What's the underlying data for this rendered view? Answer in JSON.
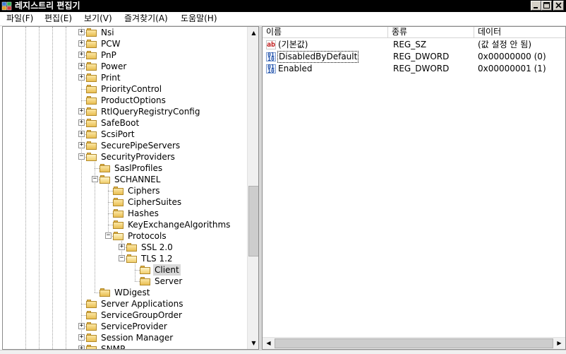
{
  "window": {
    "title": "레지스트리 편집기",
    "icon": "registry-editor-icon",
    "controls": {
      "minimize": "minimize-icon",
      "maximize": "maximize-icon",
      "close": "close-icon"
    }
  },
  "menu": [
    {
      "label": "파일(F)"
    },
    {
      "label": "편집(E)"
    },
    {
      "label": "보기(V)"
    },
    {
      "label": "즐겨찾기(A)"
    },
    {
      "label": "도움말(H)"
    }
  ],
  "tree": {
    "nodes": [
      {
        "label": "Nsi",
        "level": 0,
        "expander": "+"
      },
      {
        "label": "PCW",
        "level": 0,
        "expander": "+"
      },
      {
        "label": "PnP",
        "level": 0,
        "expander": "+"
      },
      {
        "label": "Power",
        "level": 0,
        "expander": "+"
      },
      {
        "label": "Print",
        "level": 0,
        "expander": "+"
      },
      {
        "label": "PriorityControl",
        "level": 0,
        "expander": ""
      },
      {
        "label": "ProductOptions",
        "level": 0,
        "expander": ""
      },
      {
        "label": "RtlQueryRegistryConfig",
        "level": 0,
        "expander": "+"
      },
      {
        "label": "SafeBoot",
        "level": 0,
        "expander": "+"
      },
      {
        "label": "ScsiPort",
        "level": 0,
        "expander": "+"
      },
      {
        "label": "SecurePipeServers",
        "level": 0,
        "expander": "+"
      },
      {
        "label": "SecurityProviders",
        "level": 0,
        "expander": "-"
      },
      {
        "label": "SaslProfiles",
        "level": 1,
        "expander": ""
      },
      {
        "label": "SCHANNEL",
        "level": 1,
        "expander": "-"
      },
      {
        "label": "Ciphers",
        "level": 2,
        "expander": ""
      },
      {
        "label": "CipherSuites",
        "level": 2,
        "expander": ""
      },
      {
        "label": "Hashes",
        "level": 2,
        "expander": ""
      },
      {
        "label": "KeyExchangeAlgorithms",
        "level": 2,
        "expander": ""
      },
      {
        "label": "Protocols",
        "level": 2,
        "expander": "-"
      },
      {
        "label": "SSL 2.0",
        "level": 3,
        "expander": "+"
      },
      {
        "label": "TLS 1.2",
        "level": 3,
        "expander": "-"
      },
      {
        "label": "Client",
        "level": 4,
        "expander": "",
        "selected": true
      },
      {
        "label": "Server",
        "level": 4,
        "expander": ""
      },
      {
        "label": "WDigest",
        "level": 1,
        "expander": ""
      },
      {
        "label": "Server Applications",
        "level": 0,
        "expander": ""
      },
      {
        "label": "ServiceGroupOrder",
        "level": 0,
        "expander": ""
      },
      {
        "label": "ServiceProvider",
        "level": 0,
        "expander": "+"
      },
      {
        "label": "Session Manager",
        "level": 0,
        "expander": "+"
      },
      {
        "label": "SNMP",
        "level": 0,
        "expander": "+"
      }
    ]
  },
  "list": {
    "columns": [
      {
        "label": "이름"
      },
      {
        "label": "종류"
      },
      {
        "label": "데이터"
      }
    ],
    "rows": [
      {
        "icon": "string-value-icon",
        "name": "(기본값)",
        "type": "REG_SZ",
        "data": "(값 설정 안 됨)"
      },
      {
        "icon": "binary-value-icon",
        "name": "DisabledByDefault",
        "type": "REG_DWORD",
        "data": "0x00000000 (0)",
        "focused": true
      },
      {
        "icon": "binary-value-icon",
        "name": "Enabled",
        "type": "REG_DWORD",
        "data": "0x00000001 (1)"
      }
    ]
  }
}
